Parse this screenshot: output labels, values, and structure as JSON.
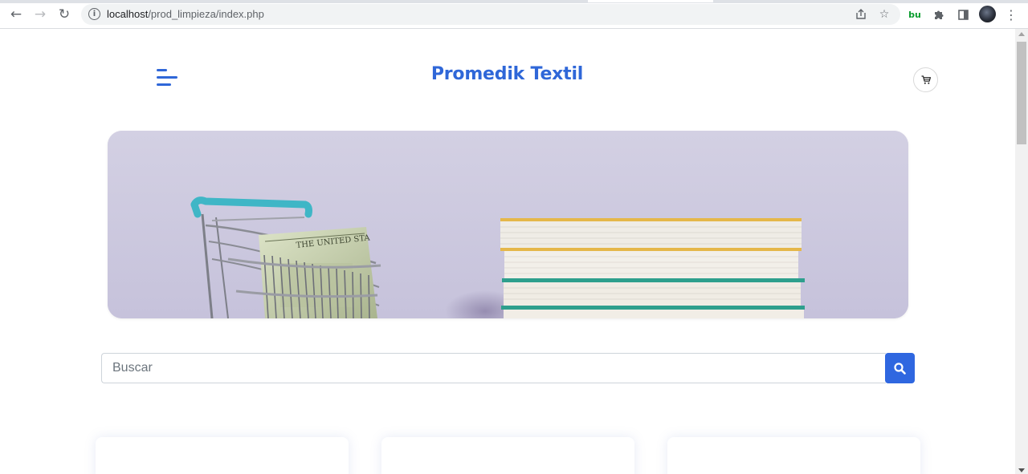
{
  "browser": {
    "url_host": "localhost",
    "url_path": "/prod_limpieza/index.php",
    "nav_icons": [
      "back-arrow-icon",
      "forward-arrow-icon",
      "reload-icon"
    ],
    "toolbar_icons": [
      "share-icon",
      "bookmark-star-icon",
      "bu-extension-icon",
      "extensions-puzzle-icon",
      "side-panel-icon",
      "profile-avatar",
      "menu-kebab-icon"
    ]
  },
  "header": {
    "brand": "Promedik Textil",
    "menu_icon": "hamburger-menu-icon",
    "cart_icon": "shopping-cart-icon"
  },
  "hero": {
    "image": "shopping-cart-with-dollars-and-book-stack",
    "background_color": "#cfcbe1"
  },
  "search": {
    "placeholder": "Buscar",
    "value": "",
    "button_icon": "search-icon",
    "button_color": "#2f67e0"
  },
  "products": {
    "cards": [
      {},
      {},
      {}
    ]
  },
  "colors": {
    "accent": "#2f67d8"
  }
}
